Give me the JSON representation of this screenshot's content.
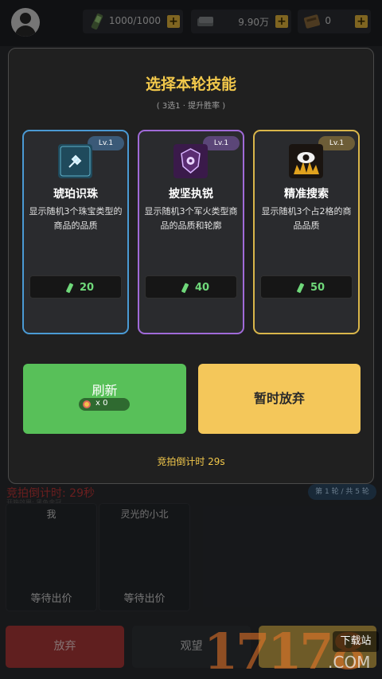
{
  "header": {
    "avatar": "avatar",
    "resources": [
      {
        "icon": "energy-bottle-icon",
        "value": "1000/1000"
      },
      {
        "icon": "cash-stack-icon",
        "value": "9.90万"
      },
      {
        "icon": "wood-crate-icon",
        "value": "0"
      }
    ],
    "plus_label": "+"
  },
  "background": {
    "timer": "竞拍倒计时: 29秒",
    "sub": "开箱效果: 黑色金冠",
    "round_badge": "第 1 轮 / 共 5 轮",
    "bidders": [
      {
        "name": "我",
        "status": "等待出价"
      },
      {
        "name": "灵光的小北",
        "status": "等待出价"
      }
    ],
    "give_up_label": "放弃",
    "watch_label": "观望"
  },
  "modal": {
    "title": "选择本轮技能",
    "subtitle": "( 3选1 · 提升胜率 )",
    "skills": [
      {
        "level": "Lv.1",
        "name": "琥珀识珠",
        "desc": "显示随机3个珠宝类型的商品的品质",
        "cost": "20",
        "border": "#4a9ad4",
        "lv_bg": "#3b5a78",
        "icon": "gem-search-icon"
      },
      {
        "level": "Lv.1",
        "name": "披坚执锐",
        "desc": "显示随机3个军火类型商品的品质和轮廓",
        "cost": "40",
        "border": "#a06ad8",
        "lv_bg": "#5b4678",
        "icon": "shield-eye-icon"
      },
      {
        "level": "Lv.1",
        "name": "精准搜索",
        "desc": "显示随机3个占2格的商品品质",
        "cost": "50",
        "border": "#d9b64a",
        "lv_bg": "#6d5d37",
        "icon": "eye-flame-icon"
      }
    ],
    "refresh_label": "刷新",
    "refresh_count": "x 0",
    "giveup_label": "暂时放弃",
    "countdown": "竞拍倒计时 29s"
  },
  "watermark": {
    "number": "17178",
    "box": "下载站",
    "com": ".COM"
  }
}
